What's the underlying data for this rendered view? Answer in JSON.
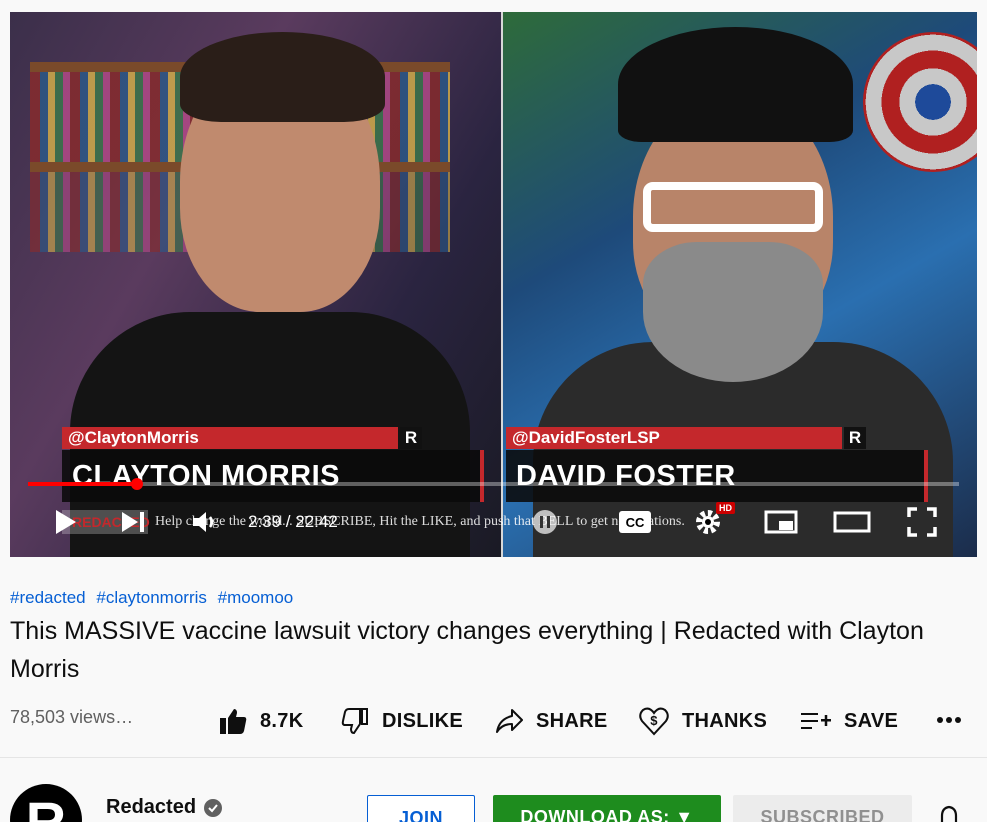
{
  "player": {
    "left_handle": "@ClaytonMorris",
    "left_name": "CLAYTON MORRIS",
    "right_handle": "@DavidFosterLSP",
    "right_name": "DAVID FOSTER",
    "badge": "R",
    "mini_label": "REDACTED",
    "marquee": "Help change the world... SUBSCRIBE, Hit the LIKE, and push that BELL to get notifications.",
    "time": "2:39 / 22:42",
    "hd_badge": "HD",
    "progress": 0.117,
    "colors": {
      "accent_red": "#ff0000",
      "lower_third_red": "#c4282c"
    }
  },
  "hashtags": [
    "#redacted",
    "#claytonmorris",
    "#moomoo"
  ],
  "title": "This MASSIVE vaccine lawsuit victory changes everything | Redacted with Clayton Morris",
  "views": "78,503 views…",
  "actions": {
    "like": "8.7K",
    "dislike": "DISLIKE",
    "share": "SHARE",
    "thanks": "THANKS",
    "save": "SAVE"
  },
  "channel": {
    "name": "Redacted",
    "avatar_letter": "R"
  },
  "buttons": {
    "join": "JOIN",
    "download": "DOWNLOAD AS: ▼",
    "subscribed": "SUBSCRIBED"
  },
  "icons": [
    "play-icon",
    "next-icon",
    "volume-icon",
    "pause-toggle-icon",
    "cc-icon",
    "settings-icon",
    "miniplayer-icon",
    "theater-icon",
    "fullscreen-icon",
    "thumbs-up-icon",
    "thumbs-down-icon",
    "share-icon",
    "thanks-icon",
    "save-playlist-icon",
    "more-icon",
    "verified-icon",
    "bell-icon"
  ]
}
